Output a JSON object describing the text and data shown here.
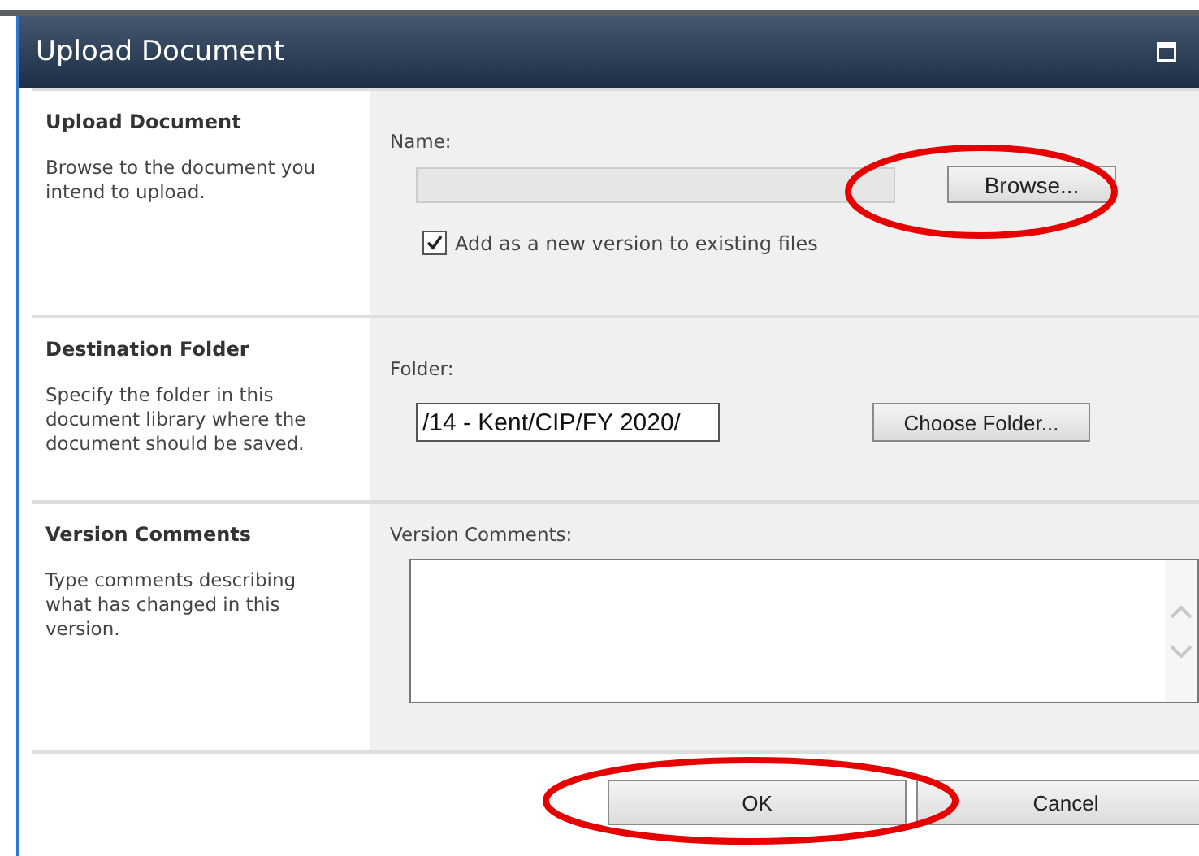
{
  "window": {
    "title": "Upload Document"
  },
  "sections": [
    {
      "kind": "file",
      "title": "Upload Document",
      "description": "Browse to the document you intend to upload.",
      "field_label": "Name:",
      "button": "Browse...",
      "button_circled": true,
      "option": {
        "label": "Add as a new version to existing files",
        "checked": true
      }
    },
    {
      "kind": "folder",
      "title": "Destination Folder",
      "description": "Specify the folder in this document library where the document should be saved.",
      "field_label": "Folder:",
      "value": "/14 - Kent/CIP/FY 2020/",
      "button": "Choose Folder..."
    },
    {
      "kind": "comments",
      "title": "Version Comments",
      "description": "Type comments describing what has changed in this version.",
      "field_label": "Version Comments:"
    }
  ],
  "buttons": [
    {
      "label": "OK",
      "circled": true
    },
    {
      "label": "Cancel",
      "circled": false
    }
  ]
}
